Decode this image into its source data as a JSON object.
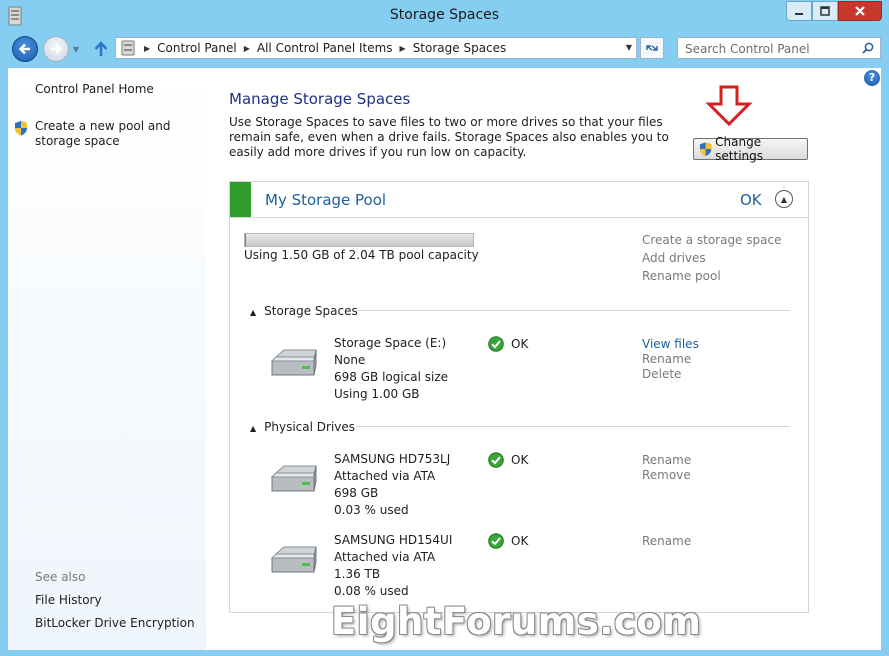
{
  "window": {
    "title": "Storage Spaces"
  },
  "navigation": {
    "breadcrumbs": [
      "Control Panel",
      "All Control Panel Items",
      "Storage Spaces"
    ],
    "search_placeholder": "Search Control Panel"
  },
  "sidebar": {
    "home": "Control Panel Home",
    "create_pool": "Create a new pool and storage space",
    "see_also": "See also",
    "links": [
      "File History",
      "BitLocker Drive Encryption"
    ]
  },
  "main": {
    "heading": "Manage Storage Spaces",
    "description": "Use Storage Spaces to save files to two or more drives so that your files remain safe, even when a drive fails. Storage Spaces also enables you to easily add more drives if you run low on capacity.",
    "change_settings": "Change settings"
  },
  "pool": {
    "name": "My Storage Pool",
    "status": "OK",
    "usage_text": "Using 1.50 GB of 2.04 TB pool capacity",
    "usage_fraction": 0.00072,
    "actions": [
      "Create a storage space",
      "Add drives",
      "Rename pool"
    ],
    "spaces_title": "Storage Spaces",
    "spaces": [
      {
        "lines": [
          "Storage Space (E:)",
          "None",
          "698 GB logical size",
          "Using 1.00 GB"
        ],
        "status": "OK",
        "links": [
          "View files",
          "Rename",
          "Delete"
        ]
      }
    ],
    "drives_title": "Physical Drives",
    "drives": [
      {
        "lines": [
          "SAMSUNG HD753LJ",
          "Attached via ATA",
          "698 GB",
          "0.03 % used"
        ],
        "status": "OK",
        "links": [
          "Rename",
          "Remove"
        ]
      },
      {
        "lines": [
          "SAMSUNG HD154UI",
          "Attached via ATA",
          "1.36 TB",
          "0.08 % used"
        ],
        "status": "OK",
        "links": [
          "Rename"
        ]
      }
    ]
  },
  "watermark": "EightForums.com",
  "colors": {
    "frame": "#86cdf2",
    "heading": "#1e3287",
    "link": "#1e5fa0",
    "pool_status_bar": "#2e9e2e",
    "annotation_arrow": "#d42020"
  },
  "icons": [
    "control-panel-icon",
    "back-arrow-icon",
    "forward-arrow-icon",
    "up-arrow-icon",
    "refresh-icon",
    "search-icon",
    "help-icon",
    "uac-shield-icon",
    "chevron-up-icon",
    "hard-drive-icon",
    "ok-check-icon",
    "red-down-arrow-icon"
  ]
}
